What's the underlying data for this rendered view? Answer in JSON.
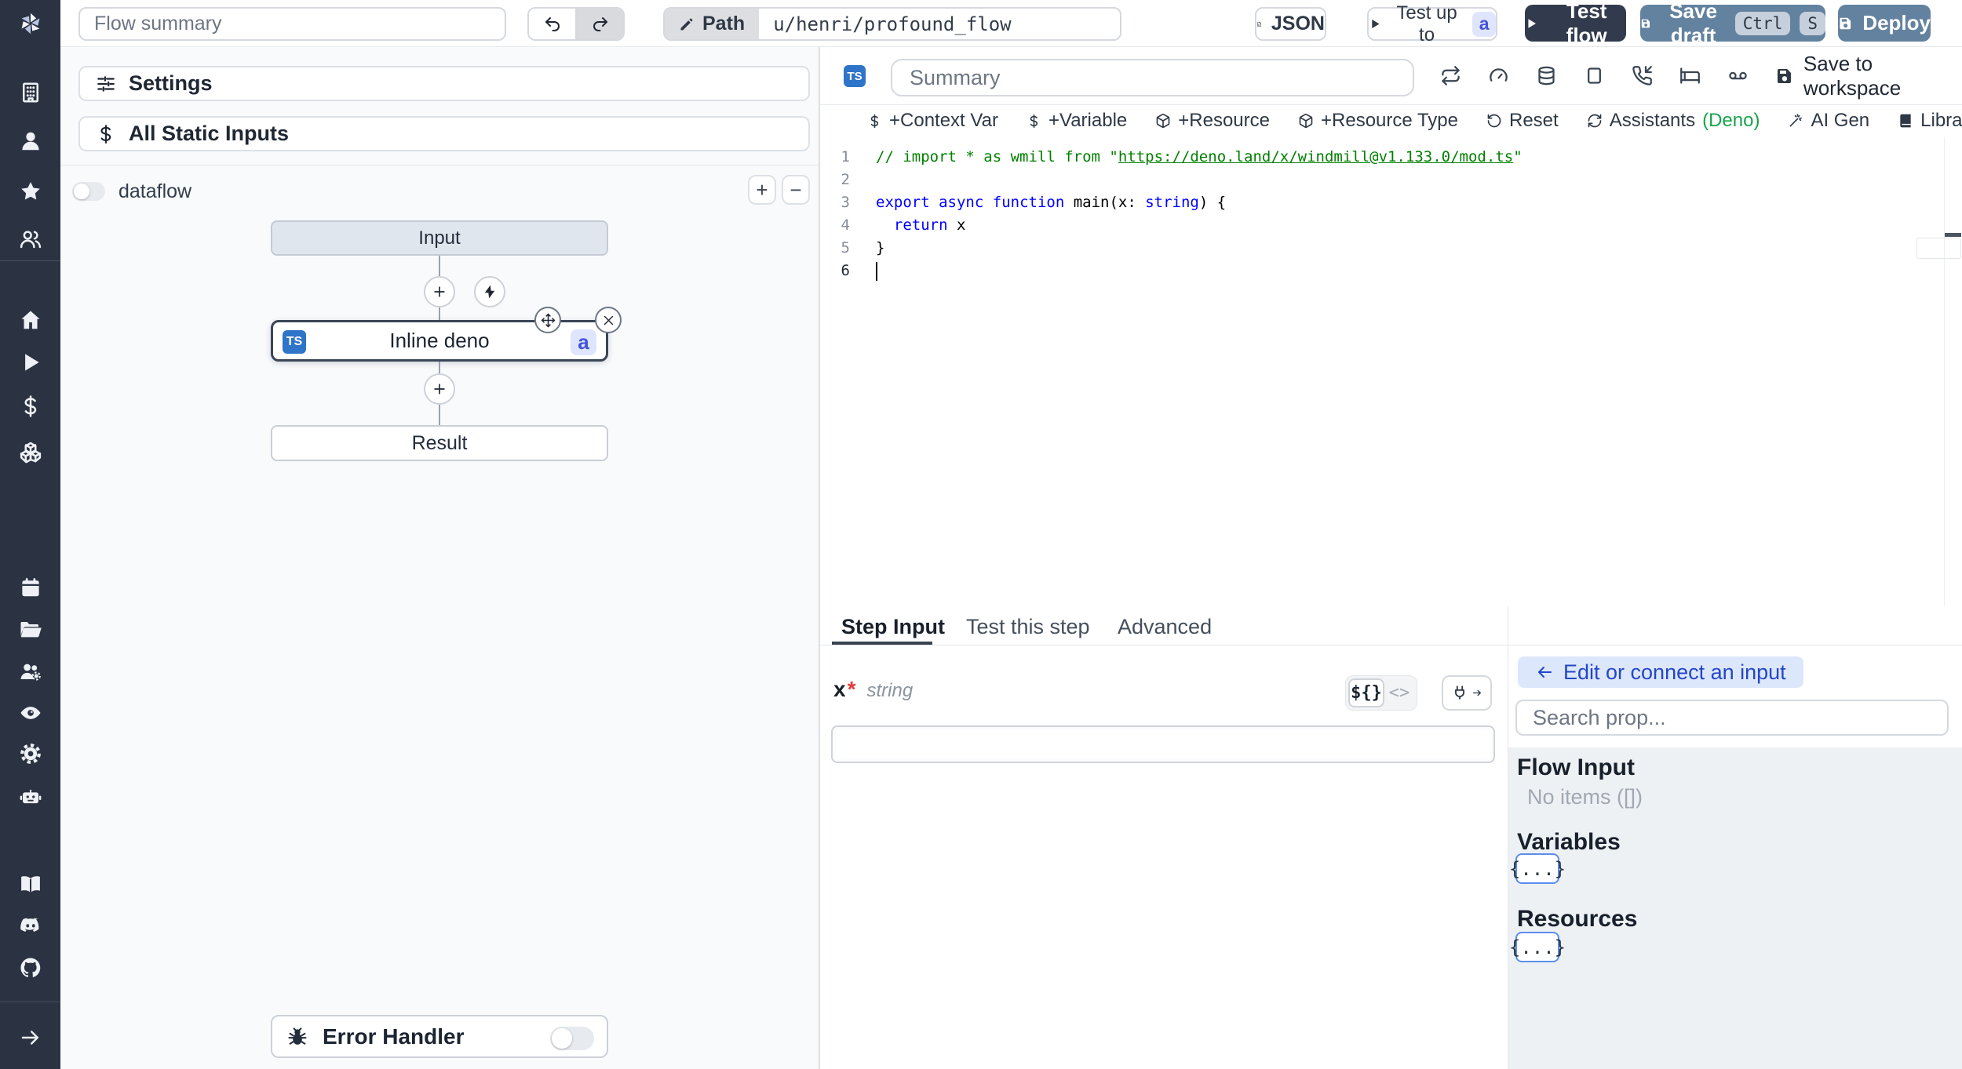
{
  "colors": {
    "sidebar_bg": "#2b3342",
    "accent_steel_blue": "#63829f",
    "dark_button": "#323b4d",
    "ts_badge_blue": "#2e74c8",
    "id_badge_bg": "#dfe5fc",
    "id_badge_text": "#4353d9",
    "green_status_dot": "#7fe9a4",
    "deno_green": "#17a34b",
    "code_comment_green": "#008000",
    "code_keyword_blue": "#0000ff",
    "connect_button_bg": "#dce7fc",
    "connect_button_text": "#2446c7"
  },
  "icons": {
    "sidebar": [
      "windmill-logo",
      "building",
      "user",
      "star",
      "users",
      "home",
      "play",
      "dollar-sign",
      "boxes",
      "calendar",
      "folder-open",
      "user-cog",
      "eye",
      "settings-gear",
      "bot",
      "book-open",
      "discord",
      "github",
      "arrow-right"
    ],
    "topbar": [
      "undo",
      "redo",
      "pencil",
      "file-json",
      "play",
      "save"
    ],
    "editor_header": [
      "repeat",
      "gauge",
      "database",
      "square",
      "phone-incoming",
      "bed",
      "voicemail",
      "save"
    ],
    "lang_toolbar": [
      "dollar-sign",
      "package",
      "rotate-ccw",
      "refresh-cw",
      "wand-sparkles",
      "library-book"
    ],
    "graph": [
      "plus",
      "zap",
      "move",
      "close-x",
      "bug"
    ],
    "step_input": [
      "plug",
      "arrow-right",
      "arrow-left"
    ]
  },
  "topbar": {
    "flow_summary_placeholder": "Flow summary",
    "path_label": "Path",
    "path_value": "u/henri/profound_flow",
    "json_label": "JSON",
    "test_up_to_label": "Test up to",
    "test_up_to_badge": "a",
    "test_flow_label": "Test flow",
    "save_draft_label": "Save draft",
    "kbd_ctrl": "Ctrl",
    "kbd_s": "S",
    "deploy_label": "Deploy"
  },
  "flow_panel": {
    "settings_label": "Settings",
    "static_inputs_label": "All Static Inputs",
    "dataflow_label": "dataflow",
    "dataflow_on": false,
    "zoom_in_label": "+",
    "zoom_out_label": "−",
    "graph": {
      "input_label": "Input",
      "step_lang_badge": "TS",
      "step_label": "Inline deno",
      "step_id_badge": "a",
      "result_label": "Result"
    },
    "error_handler_label": "Error Handler",
    "error_handler_on": false
  },
  "editor_panel": {
    "lang_badge": "TS",
    "summary_placeholder": "Summary",
    "save_to_workspace_label": "Save to workspace",
    "toolbar": {
      "context_var": "+Context Var",
      "variable": "+Variable",
      "resource": "+Resource",
      "resource_type": "+Resource Type",
      "reset": "Reset",
      "assistants": "Assistants",
      "assistants_lang": "(Deno)",
      "ai_gen": "AI Gen",
      "library": "Library"
    },
    "code": {
      "language": "deno",
      "cursor_line": 6,
      "lines": [
        [
          {
            "c": "cmt",
            "t": "// import * as wmill from \""
          },
          {
            "c": "cmtlink",
            "t": "https://deno.land/x/windmill@v1.133.0/mod.ts"
          },
          {
            "c": "cmt",
            "t": "\""
          }
        ],
        [],
        [
          {
            "c": "kw",
            "t": "export"
          },
          {
            "c": "pl",
            "t": " "
          },
          {
            "c": "kw",
            "t": "async"
          },
          {
            "c": "pl",
            "t": " "
          },
          {
            "c": "kw",
            "t": "function"
          },
          {
            "c": "pl",
            "t": " main(x: "
          },
          {
            "c": "kw",
            "t": "string"
          },
          {
            "c": "pl",
            "t": ") {"
          }
        ],
        [
          {
            "c": "pl",
            "t": "  "
          },
          {
            "c": "kw",
            "t": "return"
          },
          {
            "c": "pl",
            "t": " x"
          }
        ],
        [
          {
            "c": "pl",
            "t": "}"
          }
        ],
        []
      ]
    }
  },
  "step_panel": {
    "tabs": [
      {
        "label": "Step Input",
        "active": true
      },
      {
        "label": "Test this step",
        "active": false
      },
      {
        "label": "Advanced",
        "active": false
      }
    ],
    "arg": {
      "name": "x",
      "required_mark": "*",
      "type": "string",
      "value": "",
      "toggle_expr_label": "${}",
      "toggle_code_label": "<>"
    }
  },
  "connect_panel": {
    "edit_button_label": "Edit or connect an input",
    "search_placeholder": "Search prop...",
    "flow_input_title": "Flow Input",
    "flow_input_empty": "No items ([])",
    "variables_title": "Variables",
    "variables_chip": "{...}",
    "resources_title": "Resources",
    "resources_chip": "{...}"
  }
}
